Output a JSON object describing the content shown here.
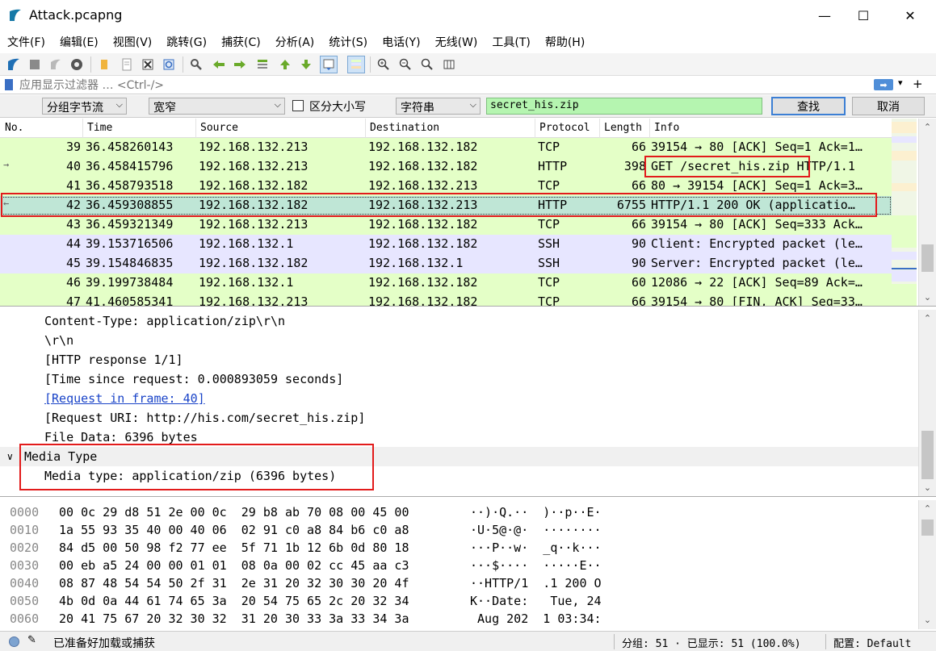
{
  "window": {
    "title": "Attack.pcapng",
    "min": "—",
    "max": "☐",
    "close": "✕"
  },
  "menu": [
    "文件(F)",
    "编辑(E)",
    "视图(V)",
    "跳转(G)",
    "捕获(C)",
    "分析(A)",
    "统计(S)",
    "电话(Y)",
    "无线(W)",
    "工具(T)",
    "帮助(H)"
  ],
  "toolbar": {
    "icons": [
      "shark-fin-icon",
      "stop-icon",
      "restart-icon",
      "options-gear-icon",
      "open-folder-icon",
      "file-icon",
      "close-file-icon",
      "reload-icon",
      "find-icon",
      "back-arrow-icon",
      "forward-arrow-icon",
      "go-to-packet-icon",
      "first-packet-icon",
      "last-packet-icon",
      "autoscroll-icon",
      "colorize-icon",
      "zoom-in-icon",
      "zoom-out-icon",
      "zoom-normal-icon",
      "resize-columns-icon"
    ]
  },
  "filter": {
    "placeholder": "应用显示过滤器 … <Ctrl-/>",
    "apply": "➡",
    "dropdown": "▾",
    "add": "+"
  },
  "find": {
    "search_in": "分组字节流",
    "char_width": "宽窄",
    "case_label": "区分大小写",
    "search_type": "字符串",
    "value": "secret_his.zip",
    "find_btn": "查找",
    "cancel_btn": "取消",
    "chevron": "⌵"
  },
  "packet_list": {
    "columns": [
      "No.",
      "Time",
      "Source",
      "Destination",
      "Protocol",
      "Length",
      "Info"
    ],
    "rows": [
      {
        "no": "39",
        "time": "36.458260143",
        "src": "192.168.132.213",
        "dst": "192.168.132.182",
        "proto": "TCP",
        "len": "66",
        "info": "39154 → 80 [ACK] Seq=1 Ack=1…",
        "bg": "#e4ffc7",
        "arrow": ""
      },
      {
        "no": "40",
        "time": "36.458415796",
        "src": "192.168.132.213",
        "dst": "192.168.132.182",
        "proto": "HTTP",
        "len": "398",
        "info": "GET /secret_his.zip HTTP/1.1",
        "bg": "#e4ffc7",
        "arrow": "→"
      },
      {
        "no": "41",
        "time": "36.458793518",
        "src": "192.168.132.182",
        "dst": "192.168.132.213",
        "proto": "TCP",
        "len": "66",
        "info": "80 → 39154 [ACK] Seq=1 Ack=3…",
        "bg": "#e4ffc7",
        "arrow": ""
      },
      {
        "no": "42",
        "time": "36.459308855",
        "src": "192.168.132.182",
        "dst": "192.168.132.213",
        "proto": "HTTP",
        "len": "6755",
        "info": "HTTP/1.1 200 OK  (applicatio…",
        "bg": "#bfe6d6",
        "arrow": "←"
      },
      {
        "no": "43",
        "time": "36.459321349",
        "src": "192.168.132.213",
        "dst": "192.168.132.182",
        "proto": "TCP",
        "len": "66",
        "info": "39154 → 80 [ACK] Seq=333 Ack…",
        "bg": "#e4ffc7",
        "arrow": ""
      },
      {
        "no": "44",
        "time": "39.153716506",
        "src": "192.168.132.1",
        "dst": "192.168.132.182",
        "proto": "SSH",
        "len": "90",
        "info": "Client: Encrypted packet (le…",
        "bg": "#e7e6ff",
        "arrow": ""
      },
      {
        "no": "45",
        "time": "39.154846835",
        "src": "192.168.132.182",
        "dst": "192.168.132.1",
        "proto": "SSH",
        "len": "90",
        "info": "Server: Encrypted packet (le…",
        "bg": "#e7e6ff",
        "arrow": ""
      },
      {
        "no": "46",
        "time": "39.199738484",
        "src": "192.168.132.1",
        "dst": "192.168.132.182",
        "proto": "TCP",
        "len": "60",
        "info": "12086 → 22 [ACK] Seq=89 Ack=…",
        "bg": "#e4ffc7",
        "arrow": ""
      },
      {
        "no": "47",
        "time": "41.460585341",
        "src": "192.168.132.213",
        "dst": "192.168.132.182",
        "proto": "TCP",
        "len": "66",
        "info": "39154 → 80 [FIN, ACK] Seq=33…",
        "bg": "#e4ffc7",
        "arrow": ""
      }
    ]
  },
  "details": {
    "lines": [
      {
        "text": "Content-Type: application/zip\\r\\n",
        "kind": "plain"
      },
      {
        "text": "\\r\\n",
        "kind": "plain"
      },
      {
        "text": "[HTTP response 1/1]",
        "kind": "plain"
      },
      {
        "text": "[Time since request: 0.000893059 seconds]",
        "kind": "plain"
      },
      {
        "text": "[Request in frame: 40]",
        "kind": "link"
      },
      {
        "text": "[Request URI: http://his.com/secret_his.zip]",
        "kind": "plain"
      },
      {
        "text": "File Data: 6396 bytes",
        "kind": "plain"
      },
      {
        "text": "Media Type",
        "kind": "section"
      },
      {
        "text": "Media type: application/zip (6396 bytes)",
        "kind": "plain"
      }
    ],
    "expander": "∨"
  },
  "bytes": {
    "rows": [
      {
        "off": "0000",
        "hex": "00 0c 29 d8 51 2e 00 0c  29 b8 ab 70 08 00 45 00",
        "asc": "··)·Q.··  )··p··E·"
      },
      {
        "off": "0010",
        "hex": "1a 55 93 35 40 00 40 06  02 91 c0 a8 84 b6 c0 a8",
        "asc": "·U·5@·@·  ········"
      },
      {
        "off": "0020",
        "hex": "84 d5 00 50 98 f2 77 ee  5f 71 1b 12 6b 0d 80 18",
        "asc": "···P··w·  _q··k···"
      },
      {
        "off": "0030",
        "hex": "00 eb a5 24 00 00 01 01  08 0a 00 02 cc 45 aa c3",
        "asc": "···$····  ·····E··"
      },
      {
        "off": "0040",
        "hex": "08 87 48 54 54 50 2f 31  2e 31 20 32 30 30 20 4f",
        "asc": "··HTTP/1  .1 200 O"
      },
      {
        "off": "0050",
        "hex": "4b 0d 0a 44 61 74 65 3a  20 54 75 65 2c 20 32 34",
        "asc": "K··Date:   Tue, 24"
      },
      {
        "off": "0060",
        "hex": "20 41 75 67 20 32 30 32  31 20 30 33 3a 33 34 3a",
        "asc": " Aug 202  1 03:34:"
      }
    ]
  },
  "status": {
    "text": "已准备好加载或捕获",
    "packets": "分组: 51 · 已显示: 51 (100.0%)",
    "profile": "配置: Default"
  },
  "scroll": {
    "up": "▲",
    "down": "▼",
    "up2": "⌃",
    "down2": "⌄"
  }
}
